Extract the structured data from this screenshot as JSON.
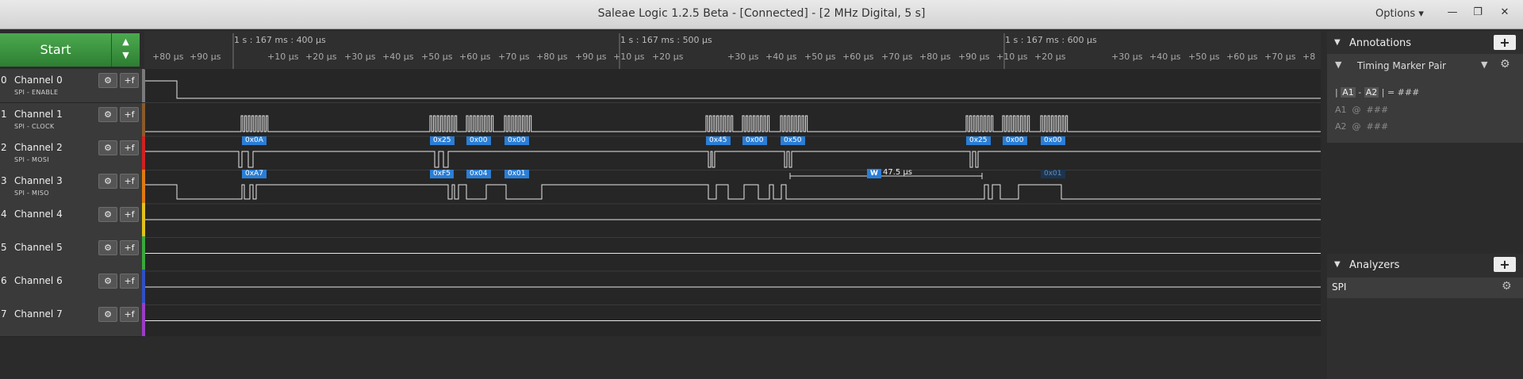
{
  "window": {
    "title": "Saleae Logic 1.2.5 Beta - [Connected] - [2 MHz Digital, 5 s]",
    "options_label": "Options",
    "minimize_glyph": "—",
    "restore_glyph": "❐",
    "close_glyph": "✕"
  },
  "toolbar": {
    "start_label": "Start",
    "arrow_up": "▲",
    "arrow_down": "▼"
  },
  "channels": [
    {
      "num": "0",
      "name": "Channel 0",
      "sub": "SPI - ENABLE",
      "color": "#7a7a7a"
    },
    {
      "num": "1",
      "name": "Channel 1",
      "sub": "SPI - CLOCK",
      "color": "#8a5a2b"
    },
    {
      "num": "2",
      "name": "Channel 2",
      "sub": "SPI - MOSI",
      "color": "#d12020"
    },
    {
      "num": "3",
      "name": "Channel 3",
      "sub": "SPI - MISO",
      "color": "#e07a10"
    },
    {
      "num": "4",
      "name": "Channel 4",
      "sub": "",
      "color": "#e2c21a"
    },
    {
      "num": "5",
      "name": "Channel 5",
      "sub": "",
      "color": "#3aa83a"
    },
    {
      "num": "6",
      "name": "Channel 6",
      "sub": "",
      "color": "#2f4fc6"
    },
    {
      "num": "7",
      "name": "Channel 7",
      "sub": "",
      "color": "#9b3cc6"
    }
  ],
  "channel_buttons": {
    "settings_glyph": "⚙",
    "trigger_glyph": "+f"
  },
  "ruler": {
    "major_labels": [
      "1 s : 167 ms : 400 μs",
      "1 s : 167 ms : 500 μs",
      "1 s : 167 ms : 600 μs"
    ],
    "minor_ticks": [
      "+80 μs",
      "+90 μs",
      "+10 μs",
      "+20 μs",
      "+30 μs",
      "+40 μs",
      "+50 μs",
      "+60 μs",
      "+70 μs",
      "+80 μs",
      "+90 μs",
      "+10 μs",
      "+20 μs",
      "+30 μs",
      "+40 μs",
      "+50 μs",
      "+60 μs",
      "+70 μs",
      "+80 μs",
      "+90 μs",
      "+10 μs",
      "+20 μs",
      "+30 μs",
      "+40 μs",
      "+50 μs",
      "+60 μs",
      "+70 μs",
      "+8"
    ]
  },
  "decoded": {
    "mosi": [
      "0x0A",
      "0x25",
      "0x00",
      "0x00",
      "0x45",
      "0x00",
      "0x50",
      "0x25",
      "0x00",
      "0x00"
    ],
    "miso": [
      "0xA7",
      "0xF5",
      "0x04",
      "0x01",
      "0x01"
    ]
  },
  "measurement": {
    "marker": "W",
    "value": "47.5 μs"
  },
  "annotations": {
    "title": "Annotations",
    "add": "+",
    "marker_pair_label": "Timing Marker Pair",
    "pair_line": {
      "a1": "A1",
      "dash": "-",
      "a2": "A2",
      "eq": "= ###"
    },
    "a1_line": "A1  @  ###",
    "a2_line": "A2  @  ###"
  },
  "analyzers": {
    "title": "Analyzers",
    "add": "+",
    "items": [
      "SPI"
    ]
  },
  "colors": {
    "accent_green": "#3d9a41",
    "decode_blue": "#2a7ed6"
  }
}
